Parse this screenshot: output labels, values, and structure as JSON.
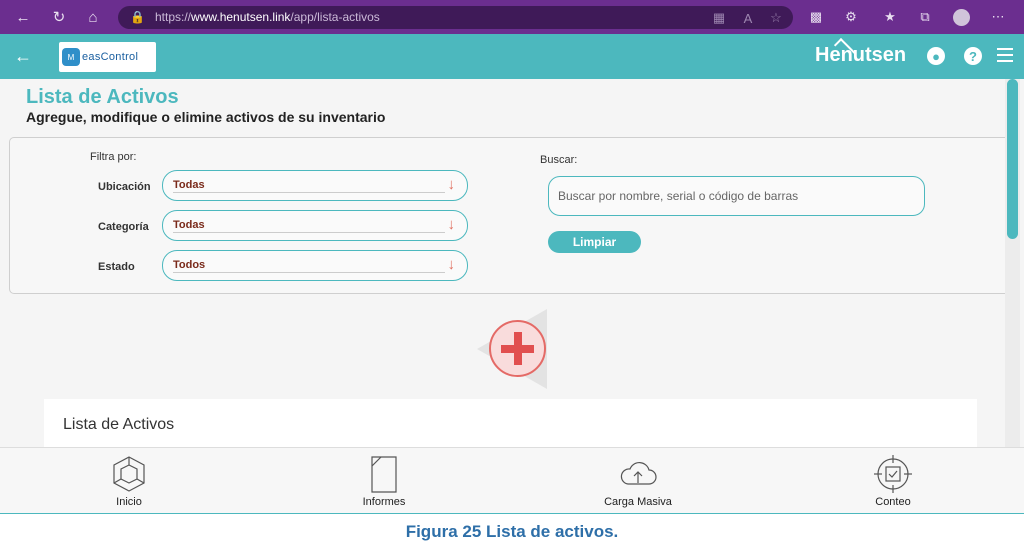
{
  "browser": {
    "url_prefix": "https://",
    "url_host": "www.henutsen.link",
    "url_path": "/app/lista-activos",
    "icons": [
      "back-icon",
      "refresh-icon",
      "home-icon",
      "lock-icon",
      "grid-icon",
      "read-aloud-icon",
      "favorite-icon",
      "extensions-icon",
      "settings-icon",
      "favorites-icon",
      "collections-icon",
      "profile-icon",
      "more-icon"
    ]
  },
  "header": {
    "logo_text": "easControl",
    "logo_mark": "M",
    "brand": "Henutsen"
  },
  "page": {
    "title": "Lista de Activos",
    "subtitle": "Agregue, modifique o elimine activos de su inventario"
  },
  "filters": {
    "heading": "Filtra por:",
    "location_label": "Ubicación",
    "location_value": "Todas",
    "category_label": "Categoría",
    "category_value": "Todas",
    "state_label": "Estado",
    "state_value": "Todos"
  },
  "search": {
    "label": "Buscar:",
    "placeholder": "Buscar por nombre, serial o código de barras",
    "clear_label": "Limpiar"
  },
  "list": {
    "title": "Lista de Activos"
  },
  "bottom_nav": {
    "home": "Inicio",
    "reports": "Informes",
    "bulk_upload": "Carga Masiva",
    "count": "Conteo"
  },
  "caption": "Figura 25 Lista de activos.",
  "colors": {
    "browser": "#6b2e8f",
    "accent": "#4cb8be",
    "add_button": "#e14f4f",
    "caption": "#2e6fa8"
  }
}
